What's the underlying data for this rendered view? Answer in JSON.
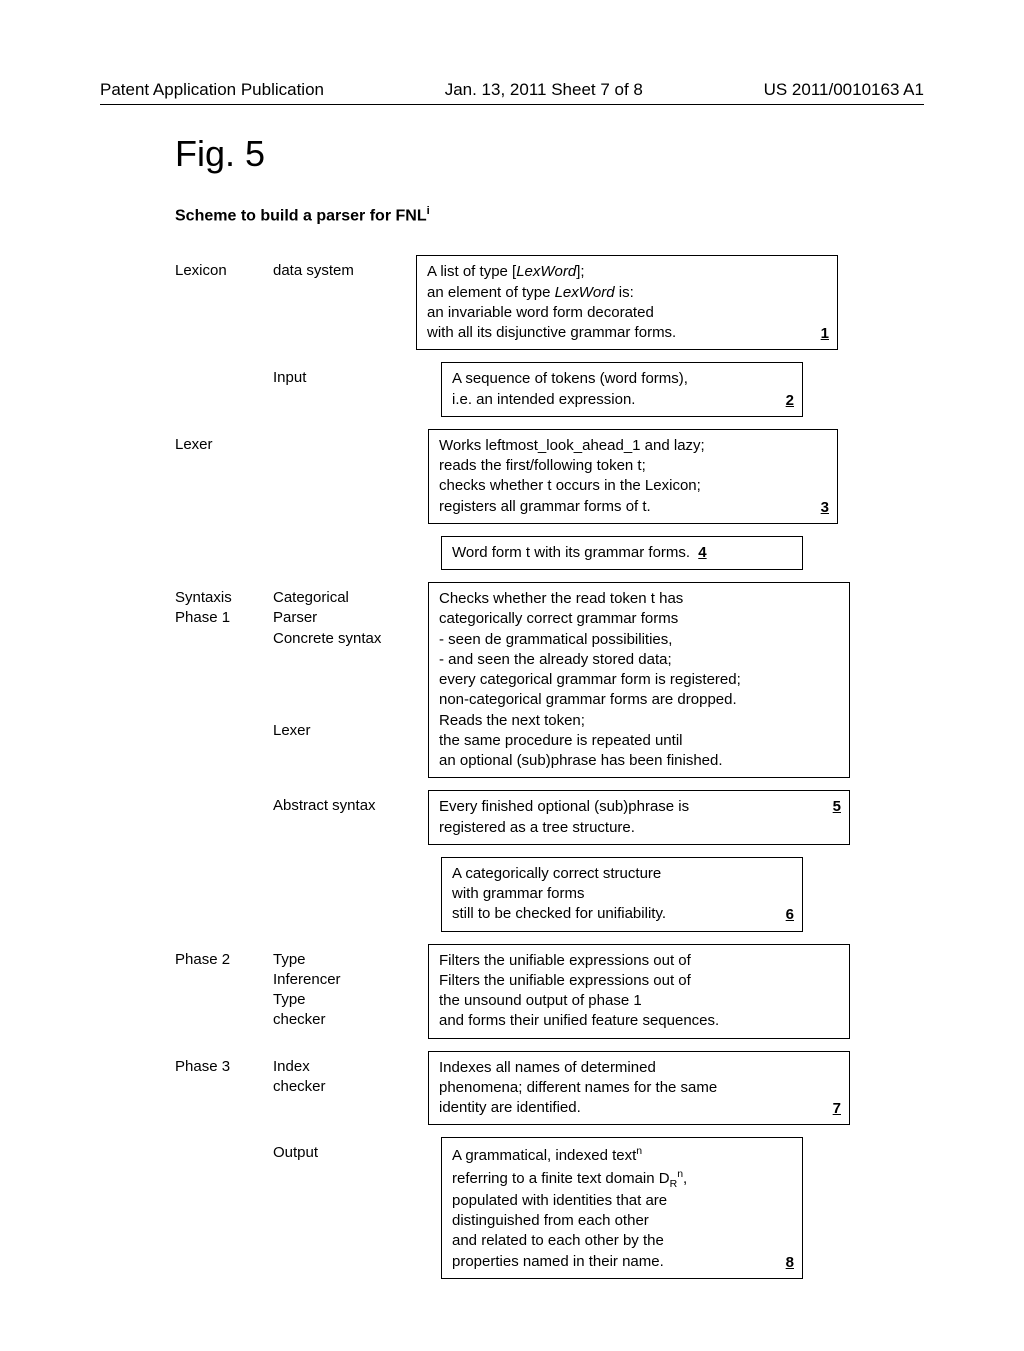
{
  "header": {
    "left": "Patent Application Publication",
    "center": "Jan. 13, 2011  Sheet 7 of 8",
    "right": "US 2011/0010163 A1"
  },
  "figure_title": "Fig. 5",
  "subtitle_prefix": "Scheme to build a parser for FNL",
  "subtitle_sup": "i",
  "labels": {
    "lexicon": "Lexicon",
    "data_system": "data system",
    "input": "Input",
    "lexer": "Lexer",
    "syntaxis": "Syntaxis",
    "phase1": "Phase 1",
    "categorical": "Categorical",
    "parser": "Parser",
    "concrete": "Concrete syntax",
    "lexer2": "Lexer",
    "abstract": "Abstract syntax",
    "phase2": "Phase 2",
    "type": "Type",
    "inferencer": "Inferencer",
    "type2": "Type",
    "checker": "checker",
    "phase3": "Phase 3",
    "index": "Index",
    "checker2": "checker",
    "output": "Output"
  },
  "box1": {
    "l1a": "A list of type [",
    "l1b": "LexWord",
    "l1c": "];",
    "l2a": "an element of type ",
    "l2b": "LexWord",
    "l2c": " is:",
    "l3": "an invariable word form decorated",
    "l4": "with all its disjunctive grammar forms.",
    "num": "1"
  },
  "box2": {
    "l1": "A sequence of tokens (word forms),",
    "l2": "i.e. an intended expression.",
    "num": "2"
  },
  "box3": {
    "l1": "Works leftmost_look_ahead_1 and lazy;",
    "l2": "reads the first/following token t;",
    "l3": "checks whether t occurs in the Lexicon;",
    "l4": "registers all grammar forms of t.",
    "num": "3"
  },
  "box4": {
    "l1": "Word form t with its grammar forms.",
    "num": "4"
  },
  "box5": {
    "l1": "Checks whether the read token t has",
    "l2": "categorically correct grammar forms",
    "l3": "- seen de grammatical possibilities,",
    "l4": "- and seen the already stored data;",
    "l5": "every categorical grammar form is registered;",
    "l6": "non-categorical grammar forms are dropped.",
    "l7": "Reads the next token;",
    "l8": "the same procedure is repeated until",
    "l9": "an optional (sub)phrase has been finished."
  },
  "box5b": {
    "l1": "Every finished optional (sub)phrase is",
    "l2": "registered as a tree structure.",
    "num": "5"
  },
  "box6": {
    "l1": "A categorically correct structure",
    "l2": "with grammar forms",
    "l3": "still to be checked for unifiability.",
    "num": "6"
  },
  "box7a": {
    "l1": "Filters the unifiable expressions out of",
    "l2": "Filters the unifiable expressions out of",
    "l3": "the unsound output of phase 1",
    "l4": "and forms their unified feature sequences."
  },
  "box7": {
    "l1": "Indexes all names of determined",
    "l2": "phenomena; different names for the same",
    "l3": "identity are identified.",
    "num": "7"
  },
  "box8": {
    "l1a": "A grammatical, indexed text",
    "l1sup": "n",
    "l2a": "referring to a finite text domain D",
    "l2sub": "R",
    "l2sup": "n",
    "l2b": ",",
    "l3": "populated with identities that are",
    "l4": "distinguished from each other",
    "l5": "and related to each other by the",
    "l6": "properties named in their name.",
    "num": "8"
  }
}
